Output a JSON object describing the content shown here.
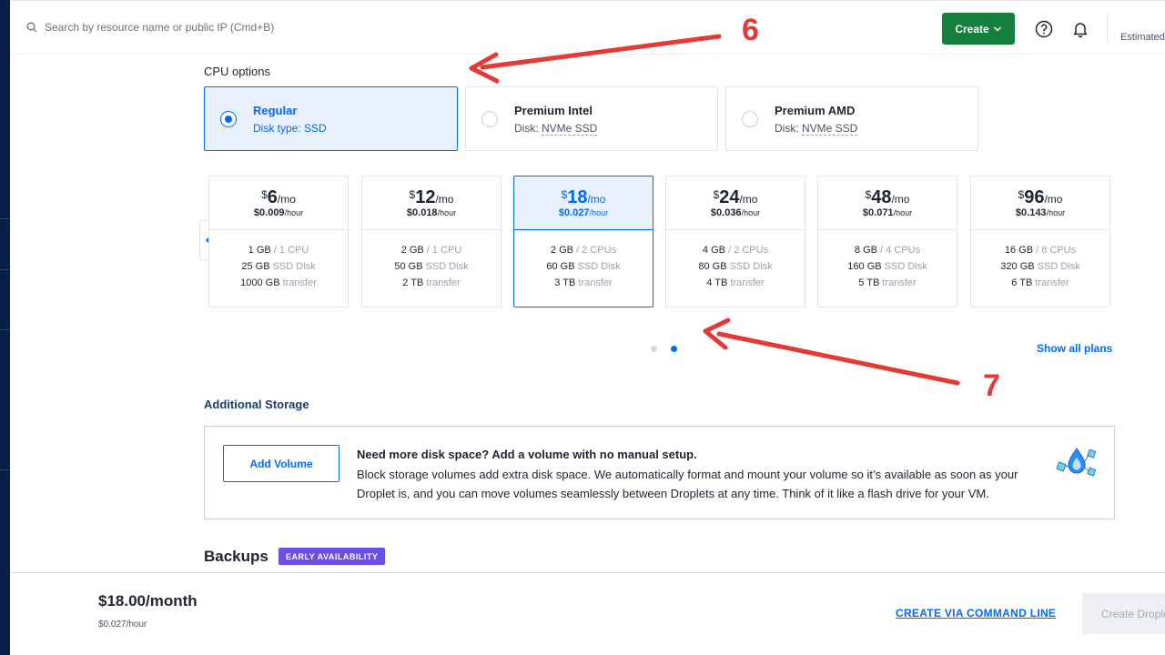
{
  "topbar": {
    "search_placeholder": "Search by resource name or public IP (Cmd+B)",
    "create_label": "Create",
    "estimated_label": "Estimated"
  },
  "cpu_options": {
    "title": "CPU options",
    "cards": [
      {
        "name": "Regular",
        "disk_prefix": "Disk type: ",
        "disk_type": "SSD",
        "selected": true
      },
      {
        "name": "Premium Intel",
        "disk_prefix": "Disk: ",
        "disk_type": "NVMe SSD",
        "selected": false
      },
      {
        "name": "Premium AMD",
        "disk_prefix": "Disk: ",
        "disk_type": "NVMe SSD",
        "selected": false
      }
    ]
  },
  "plans": [
    {
      "currency": "$",
      "amount": "6",
      "per": "/mo",
      "hourly": "$0.009",
      "hour_unit": "/hour",
      "memory": "1 GB",
      "cpu": "/ 1 CPU",
      "disk": "25 GB",
      "disk_label": "SSD Disk",
      "transfer": "1000 GB",
      "transfer_label": "transfer",
      "selected": false
    },
    {
      "currency": "$",
      "amount": "12",
      "per": "/mo",
      "hourly": "$0.018",
      "hour_unit": "/hour",
      "memory": "2 GB",
      "cpu": "/ 1 CPU",
      "disk": "50 GB",
      "disk_label": "SSD Disk",
      "transfer": "2 TB",
      "transfer_label": "transfer",
      "selected": false
    },
    {
      "currency": "$",
      "amount": "18",
      "per": "/mo",
      "hourly": "$0.027",
      "hour_unit": "/hour",
      "memory": "2 GB",
      "cpu": "/ 2 CPUs",
      "disk": "60 GB",
      "disk_label": "SSD Disk",
      "transfer": "3 TB",
      "transfer_label": "transfer",
      "selected": true
    },
    {
      "currency": "$",
      "amount": "24",
      "per": "/mo",
      "hourly": "$0.036",
      "hour_unit": "/hour",
      "memory": "4 GB",
      "cpu": "/ 2 CPUs",
      "disk": "80 GB",
      "disk_label": "SSD Disk",
      "transfer": "4 TB",
      "transfer_label": "transfer",
      "selected": false
    },
    {
      "currency": "$",
      "amount": "48",
      "per": "/mo",
      "hourly": "$0.071",
      "hour_unit": "/hour",
      "memory": "8 GB",
      "cpu": "/ 4 CPUs",
      "disk": "160 GB",
      "disk_label": "SSD Disk",
      "transfer": "5 TB",
      "transfer_label": "transfer",
      "selected": false
    },
    {
      "currency": "$",
      "amount": "96",
      "per": "/mo",
      "hourly": "$0.143",
      "hour_unit": "/hour",
      "memory": "16 GB",
      "cpu": "/ 8 CPUs",
      "disk": "320 GB",
      "disk_label": "SSD Disk",
      "transfer": "6 TB",
      "transfer_label": "transfer",
      "selected": false
    }
  ],
  "pagination": {
    "pages": 2,
    "active_page": 2
  },
  "show_all_label": "Show all plans",
  "storage": {
    "title": "Additional Storage",
    "button_label": "Add Volume",
    "heading": "Need more disk space? Add a volume with no manual setup.",
    "description": "Block storage volumes add extra disk space. We automatically format and mount your volume so it’s available as soon as your Droplet is, and you can move volumes seamlessly between Droplets at any time. Think of it like a flash drive for your VM."
  },
  "backups": {
    "title": "Backups",
    "badge": "EARLY AVAILABILITY"
  },
  "footer": {
    "monthly": "$18.00/month",
    "hourly": "$0.027/hour",
    "cli_label": "CREATE VIA COMMAND LINE",
    "create_label": "Create Droplet"
  },
  "annotations": {
    "cpu_marker": "6",
    "pagination_marker": "7",
    "color": "#e53935"
  },
  "colors": {
    "accent": "#0069ff",
    "create_green": "#15803d",
    "badge_purple": "#6c4ee8",
    "rail_navy": "#0a1f44"
  }
}
